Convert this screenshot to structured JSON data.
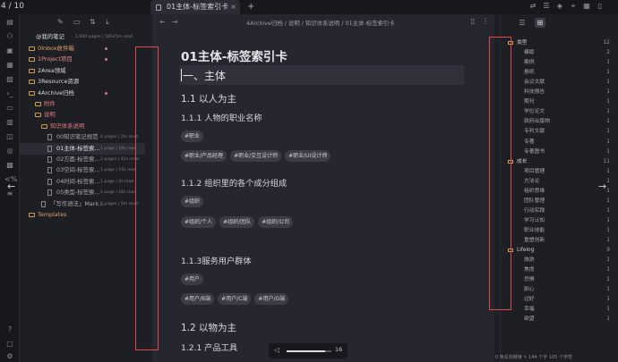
{
  "top": {
    "counter": "4 / 10",
    "tab_title": "01主体-标签索引卡",
    "tab_close": "×",
    "tab_add": "+"
  },
  "file_explorer": {
    "vault_name": "@我的笔记",
    "vault_meta": "1,690 pages | 58h25m read",
    "items": [
      {
        "label": "0Inbox收件箱",
        "kind": "folder",
        "depth": 1,
        "color": "#e0a06b",
        "meta": "",
        "dot": true
      },
      {
        "label": "1Project项目",
        "kind": "folder",
        "depth": 1,
        "color": "#e78a8a",
        "meta": "",
        "dot": true
      },
      {
        "label": "2Area领域",
        "kind": "folder",
        "depth": 1,
        "color": "#d8d8dc",
        "meta": "",
        "dot": false
      },
      {
        "label": "3Resource资源",
        "kind": "folder",
        "depth": 1,
        "color": "#d8d8dc",
        "meta": "",
        "dot": false
      },
      {
        "label": "4Archive归档",
        "kind": "folder",
        "depth": 1,
        "color": "#d8d8dc",
        "meta": "",
        "dot": true
      },
      {
        "label": "附件",
        "kind": "folder",
        "depth": 2,
        "color": "#e07b7b",
        "meta": "",
        "dot": false
      },
      {
        "label": "说明",
        "kind": "folder",
        "depth": 2,
        "color": "#e07b7b",
        "meta": "",
        "dot": false
      },
      {
        "label": "知识体系说明",
        "kind": "folder",
        "depth": 3,
        "color": "#e07b7b",
        "meta": "",
        "dot": false
      },
      {
        "label": "00知识笔记规范",
        "kind": "file",
        "depth": 4,
        "color": "#a9aab1",
        "meta": "6 pages | 2m read",
        "dot": false
      },
      {
        "label": "01主体-标签索...",
        "kind": "file",
        "depth": 4,
        "color": "#e6e6ea",
        "meta": "1 page | 19s read",
        "dot": false
      },
      {
        "label": "02方面-标签索...",
        "kind": "file",
        "depth": 4,
        "color": "#a9aab1",
        "meta": "2 pages | 41s read",
        "dot": false
      },
      {
        "label": "03空间-标签索...",
        "kind": "file",
        "depth": 4,
        "color": "#a9aab1",
        "meta": "1 page | 10s read",
        "dot": false
      },
      {
        "label": "04时间-标签索...",
        "kind": "file",
        "depth": 4,
        "color": "#a9aab1",
        "meta": "1 page | 4s read",
        "dot": false
      },
      {
        "label": "05类型-标签索...",
        "kind": "file",
        "depth": 4,
        "color": "#a9aab1",
        "meta": "1 page | 16s read",
        "dot": false
      },
      {
        "label": "「写作语法」Mark...",
        "kind": "file",
        "depth": 3,
        "color": "#a9aab1",
        "meta": "8 pages | 5m read",
        "dot": false
      },
      {
        "label": "Templates",
        "kind": "folder",
        "depth": 1,
        "color": "#e0a06b",
        "meta": "",
        "dot": false
      }
    ]
  },
  "editor": {
    "nav_back": "←",
    "nav_forward": "→",
    "breadcrumb": "4Archive归档 / 说明 / 知识体系说明 / 01主体-标签索引卡",
    "title": "01主体-标签索引卡",
    "h1": "一、主体",
    "s1": "1.1 以人为主",
    "s1_1": "1.1.1 人物的职业名称",
    "tags_a": [
      "#职业"
    ],
    "tags_b": [
      "#职业/产品经理",
      "#职业/交互设计师",
      "#职业/UI设计师"
    ],
    "s1_2": "1.1.2 组织里的各个成分组成",
    "tags_c": [
      "#组织"
    ],
    "tags_d": [
      "#组织/个人",
      "#组织/团队",
      "#组织/公司"
    ],
    "s1_3": "1.1.3服务用户群体",
    "tags_e": [
      "#用户"
    ],
    "tags_f": [
      "#用户/B端",
      "#用户/C端",
      "#用户/G端"
    ],
    "s2": "1.2 以物为主",
    "s2_1": "1.2.1 产品工具"
  },
  "media": {
    "volume_value": "16",
    "volume_level": 0.85
  },
  "tag_pane": {
    "groups": [
      {
        "name": "类型",
        "count": "12",
        "children": [
          [
            "模版",
            "2"
          ],
          [
            "案例",
            "1"
          ],
          [
            "报纸",
            "1"
          ],
          [
            "会议文献",
            "1"
          ],
          [
            "科技报告",
            "1"
          ],
          [
            "期刊",
            "1"
          ],
          [
            "学位论文",
            "1"
          ],
          [
            "政府出版物",
            "1"
          ],
          [
            "专利文献",
            "1"
          ],
          [
            "专著",
            "1"
          ],
          [
            "专著图书",
            "1"
          ]
        ]
      },
      {
        "name": "成长",
        "count": "11",
        "children": [
          [
            "项目管理",
            "1"
          ],
          [
            "方法论",
            "1"
          ],
          [
            "组织思维",
            "1"
          ],
          [
            "团队管理",
            "1"
          ],
          [
            "行动实践",
            "1"
          ],
          [
            "学习认知",
            "1"
          ],
          [
            "职业技能",
            "1"
          ],
          [
            "重塑创新",
            "1"
          ]
        ]
      },
      {
        "name": "Lifelog",
        "count": "9",
        "children": [
          [
            "旅游",
            "1"
          ],
          [
            "焦虑",
            "1"
          ],
          [
            "恐惧",
            "1"
          ],
          [
            "耐心",
            "1"
          ],
          [
            "过好",
            "1"
          ],
          [
            "幸福",
            "1"
          ],
          [
            "欲望",
            "1"
          ]
        ]
      }
    ]
  },
  "status": {
    "text": "0 条反向链接  ✎  144 个字  105 个字符"
  }
}
